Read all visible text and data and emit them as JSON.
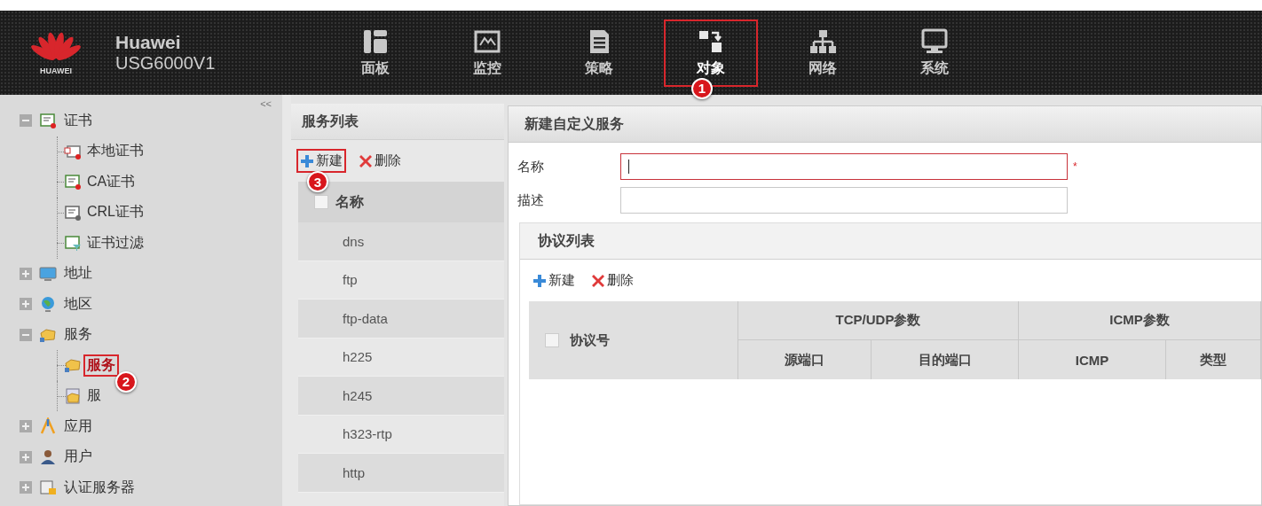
{
  "header": {
    "brand": "HUAWEI",
    "title": "Huawei",
    "model": "USG6000V1",
    "nav": [
      {
        "label": "面板",
        "selected": false
      },
      {
        "label": "监控",
        "selected": false
      },
      {
        "label": "策略",
        "selected": false
      },
      {
        "label": "对象",
        "selected": true,
        "callout": "1"
      },
      {
        "label": "网络",
        "selected": false
      },
      {
        "label": "系统",
        "selected": false
      }
    ]
  },
  "sidebar": {
    "collapse": "<<",
    "items": [
      {
        "label": "证书",
        "expanded": true,
        "children": [
          {
            "label": "本地证书",
            "selected": false
          },
          {
            "label": "CA证书",
            "selected": false
          },
          {
            "label": "CRL证书",
            "selected": false
          },
          {
            "label": "证书过滤",
            "selected": false
          }
        ]
      },
      {
        "label": "地址",
        "expanded": false
      },
      {
        "label": "地区",
        "expanded": false
      },
      {
        "label": "服务",
        "expanded": true,
        "children": [
          {
            "label": "服务",
            "selected": true,
            "callout": "2"
          },
          {
            "label": "服",
            "selected": false
          }
        ]
      },
      {
        "label": "应用",
        "expanded": false
      },
      {
        "label": "用户",
        "expanded": false
      },
      {
        "label": "认证服务器",
        "expanded": false
      }
    ]
  },
  "service_list": {
    "title": "服务列表",
    "toolbar": [
      {
        "kind": "add",
        "label": "新建",
        "callout": "3"
      },
      {
        "kind": "delete",
        "label": "删除"
      }
    ],
    "column": "名称",
    "checked": false,
    "rows": [
      "dns",
      "ftp",
      "ftp-data",
      "h225",
      "h245",
      "h323-rtp",
      "http"
    ]
  },
  "dialog": {
    "title": "新建自定义服务",
    "fields": [
      {
        "label": "名称",
        "marker": "*",
        "focused": true
      },
      {
        "label": "描述",
        "focused": false
      }
    ],
    "protocol_list": {
      "title": "协议列表",
      "toolbar": [
        {
          "kind": "add",
          "label": "新建"
        },
        {
          "kind": "delete",
          "label": "删除"
        }
      ],
      "checked": false,
      "column": "协议号",
      "groups": [
        {
          "label": "TCP/UDP参数",
          "columns": [
            "源端口",
            "目的端口"
          ]
        },
        {
          "label": "ICMP参数",
          "columns": [
            "ICMP",
            "类型"
          ]
        }
      ]
    }
  }
}
